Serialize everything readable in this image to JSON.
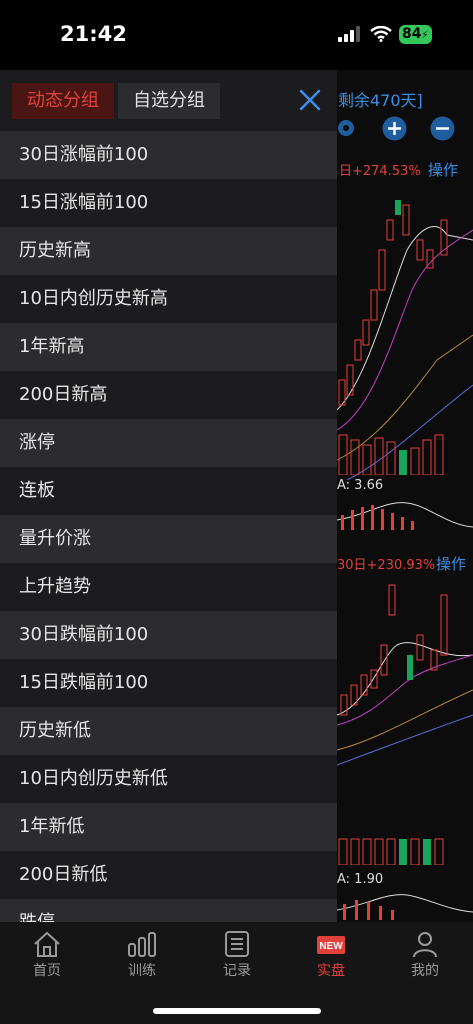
{
  "status_bar": {
    "time": "21:42",
    "battery": "84"
  },
  "background": {
    "header_text": "剩余470天]",
    "panel1_stat": "日+274.53%",
    "panel1_action": "操作",
    "panel1_macd": "A: 3.66",
    "panel2_stat": "30日+230.93%",
    "panel2_action": "操作",
    "panel2_macd": "A: 1.90"
  },
  "menu": {
    "tabs": [
      {
        "label": "动态分组",
        "active": true
      },
      {
        "label": "自选分组",
        "active": false
      }
    ],
    "items": [
      "30日涨幅前100",
      "15日涨幅前100",
      "历史新高",
      "10日内创历史新高",
      "1年新高",
      "200日新高",
      "涨停",
      "连板",
      "量升价涨",
      "上升趋势",
      "30日跌幅前100",
      "15日跌幅前100",
      "历史新低",
      "10日内创历史新低",
      "1年新低",
      "200日新低",
      "跌停"
    ]
  },
  "tabbar": {
    "items": [
      {
        "label": "首页",
        "icon": "home-icon"
      },
      {
        "label": "训练",
        "icon": "bar-chart-icon"
      },
      {
        "label": "记录",
        "icon": "list-icon"
      },
      {
        "label": "实盘",
        "icon": "new-badge-icon",
        "badge": "NEW",
        "active": true
      },
      {
        "label": "我的",
        "icon": "person-icon"
      }
    ]
  },
  "colors": {
    "accent_red": "#e2413b",
    "blue": "#3a8ee6",
    "battery_green": "#34c759"
  }
}
